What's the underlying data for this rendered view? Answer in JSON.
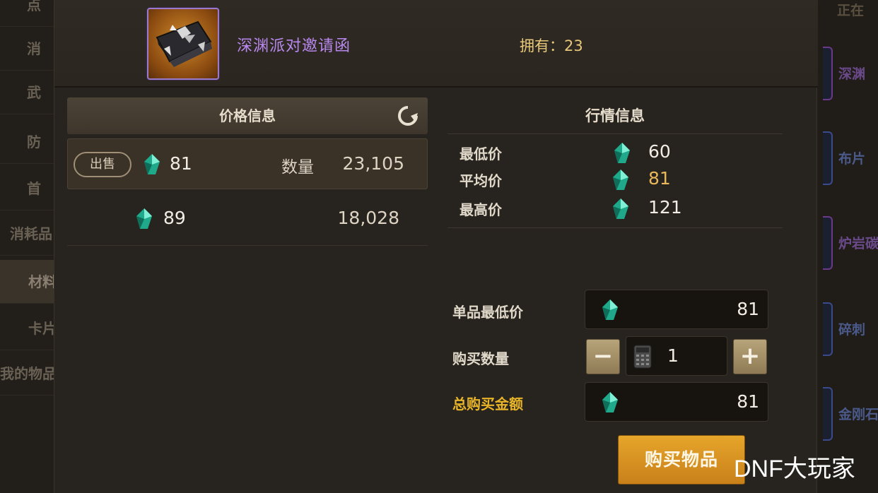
{
  "item": {
    "name": "深渊派对邀请函",
    "owned_label": "拥有：",
    "owned_count": "23",
    "icon": "abyss-party-invitation-icon"
  },
  "price_info": {
    "title": "价格信息",
    "rows": [
      {
        "action": "出售",
        "price": "81",
        "qty_label": "数量",
        "qty": "23,105"
      },
      {
        "price": "89",
        "qty": "18,028"
      }
    ]
  },
  "market_info": {
    "title": "行情信息",
    "rows": [
      {
        "label": "最低价",
        "value": "60"
      },
      {
        "label": "平均价",
        "value": "81"
      },
      {
        "label": "最高价",
        "value": "121"
      }
    ]
  },
  "purchase": {
    "unit_min_label": "单品最低价",
    "unit_min_value": "81",
    "qty_label": "购买数量",
    "qty_value": "1",
    "minus": "−",
    "plus": "+",
    "total_label": "总购买金额",
    "total_value": "81",
    "buy_button": "购买物品"
  },
  "background": {
    "left_tabs": [
      "点",
      "消",
      "武",
      "防",
      "首",
      "消耗品",
      "材料",
      "卡片",
      "我的物品"
    ],
    "right_items": [
      "深渊",
      "布片",
      "炉岩碳",
      "碎刺",
      "金刚石"
    ],
    "right_top": "正在"
  },
  "watermark": "DNF大玩家",
  "colors": {
    "accent_gold": "#e8b428",
    "item_name_purple": "#b888ee",
    "avg_price": "#e8b85a",
    "buy_button": "#d8921f"
  }
}
